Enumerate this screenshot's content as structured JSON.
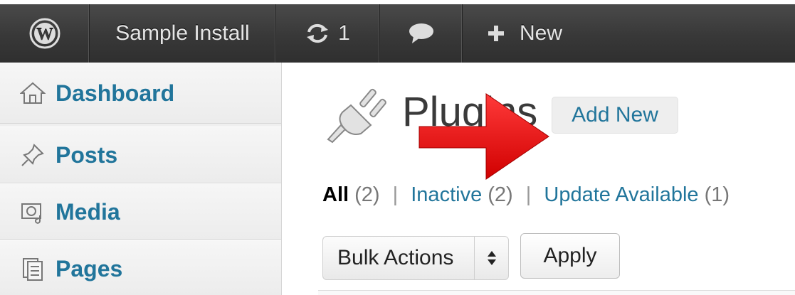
{
  "adminbar": {
    "logo_icon": "wordpress-logo-icon",
    "site_name": "Sample Install",
    "updates_icon": "refresh-icon",
    "updates_count": "1",
    "comments_icon": "comment-bubble-icon",
    "new_icon": "plus-icon",
    "new_label": "New"
  },
  "sidebar": {
    "items": [
      {
        "label": "Dashboard",
        "icon": "home-icon"
      },
      {
        "label": "Posts",
        "icon": "pushpin-icon"
      },
      {
        "label": "Media",
        "icon": "media-icon"
      },
      {
        "label": "Pages",
        "icon": "pages-icon"
      }
    ]
  },
  "main": {
    "title": "Plugins",
    "title_icon": "plug-icon",
    "add_new_label": "Add New",
    "filters": {
      "all_label": "All",
      "all_count": "(2)",
      "inactive_label": "Inactive",
      "inactive_count": "(2)",
      "update_label": "Update Available",
      "update_count": "(1)",
      "separator": "|"
    },
    "bulk_actions_label": "Bulk Actions",
    "apply_label": "Apply"
  },
  "overlay": {
    "arrow_color": "#e01010"
  },
  "colors": {
    "link": "#21759b",
    "adminbar": "#3a3a3a",
    "sidebar_bg": "#efefef"
  }
}
